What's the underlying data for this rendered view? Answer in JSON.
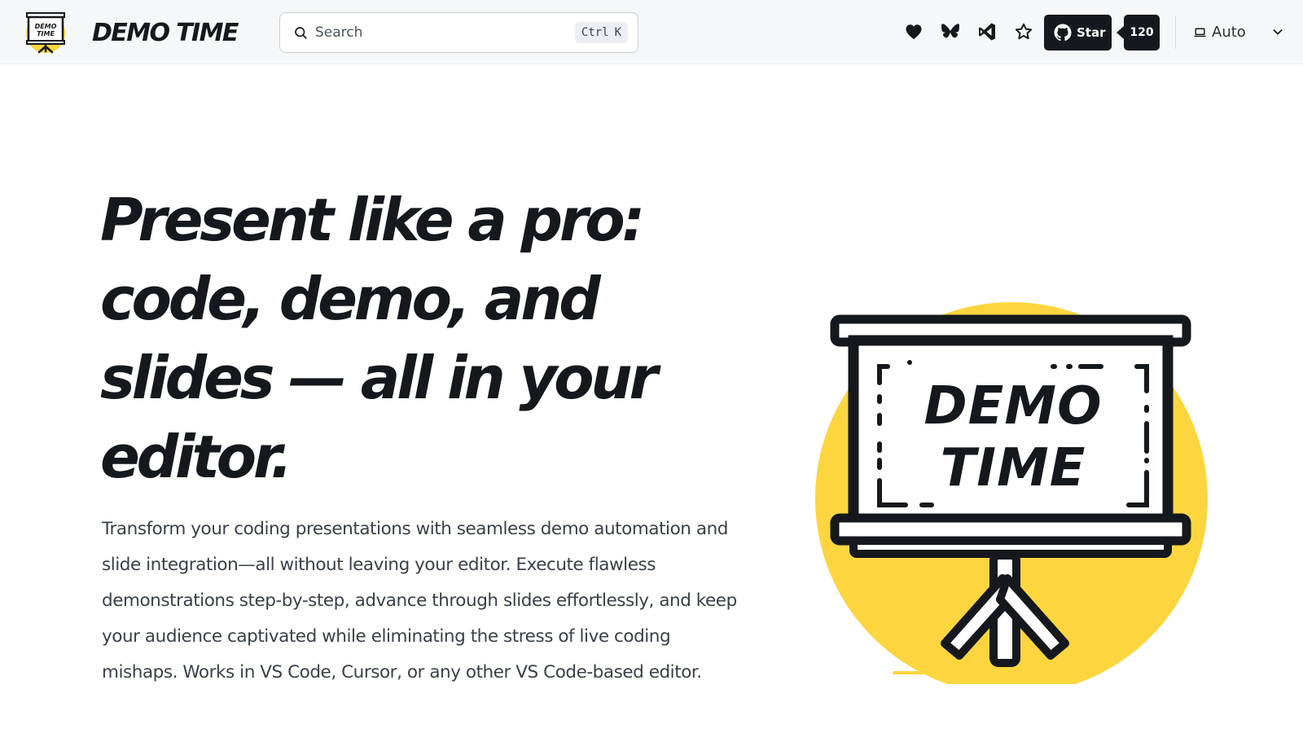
{
  "header": {
    "brand": "DEMO TIME",
    "logo_text": "DEMO TIME",
    "search": {
      "placeholder": "Search",
      "shortcut_modifier": "Ctrl",
      "shortcut_key": "K"
    },
    "social_icons": [
      "heart-icon",
      "bluesky-icon",
      "vscode-icon",
      "star-outline-icon"
    ],
    "github": {
      "star_label": "Star",
      "star_count": "120"
    },
    "theme": {
      "selected": "Auto"
    }
  },
  "hero": {
    "title": "Present like a pro: code, demo, and slides — all in your editor.",
    "description": "Transform your coding presentations with seamless demo automation and slide integration—all without leaving your editor. Execute flawless demonstrations step-by-step, advance through slides effortlessly, and keep your audience captivated while eliminating the stress of live coding mishaps. Works in VS Code, Cursor, or any other VS Code-based editor."
  },
  "illustration": {
    "board_line1": "DEMO",
    "board_line2": "TIME"
  },
  "colors": {
    "accent": "#fcd53f",
    "ink": "#15181c",
    "header_bg": "#f6f7f9"
  }
}
